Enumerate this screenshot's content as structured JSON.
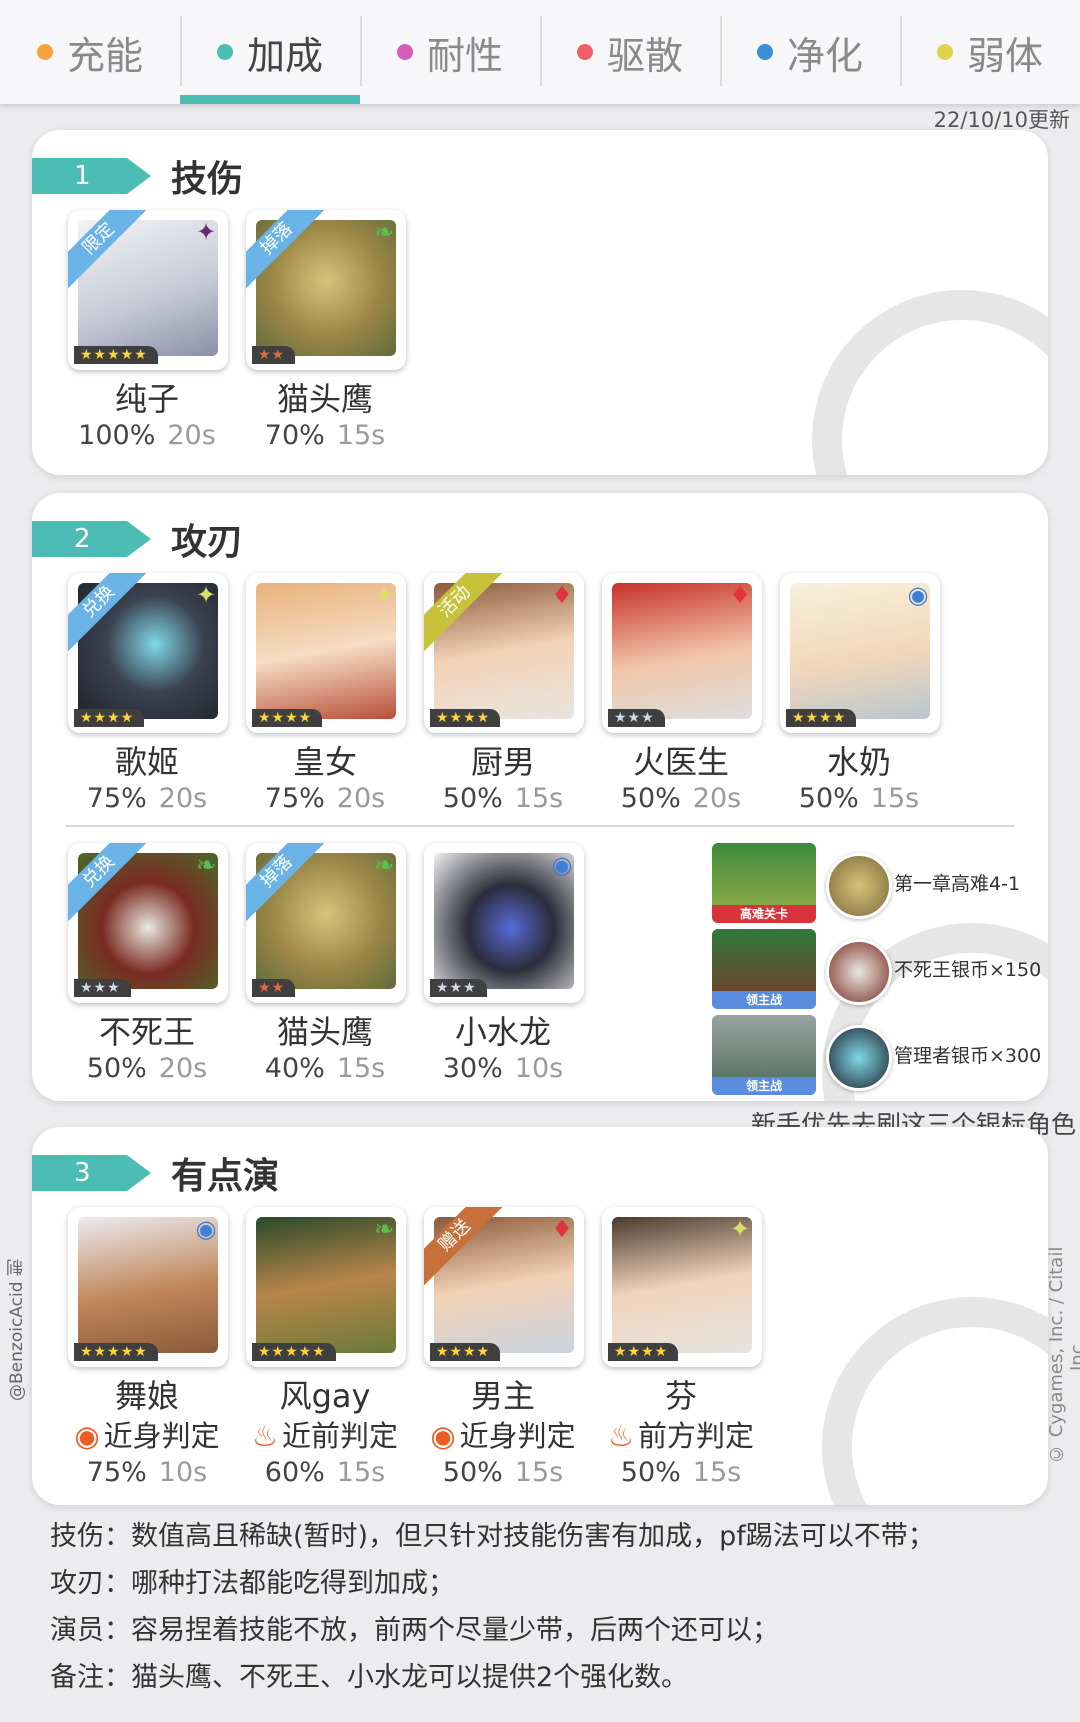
{
  "tabs": [
    {
      "label": "充能",
      "color": "#f5a33a",
      "active": false
    },
    {
      "label": "加成",
      "color": "#4cbdb4",
      "active": true
    },
    {
      "label": "耐性",
      "color": "#d65db8",
      "active": false
    },
    {
      "label": "驱散",
      "color": "#ef5f6b",
      "active": false
    },
    {
      "label": "净化",
      "color": "#3b8ed8",
      "active": false
    },
    {
      "label": "弱体",
      "color": "#dfd24c",
      "active": false
    }
  ],
  "update_text": "22/10/10更新",
  "sections": [
    {
      "num": "1",
      "title": "技伤"
    },
    {
      "num": "2",
      "title": "攻刃"
    },
    {
      "num": "3",
      "title": "有点演"
    }
  ],
  "s1": [
    {
      "name": "纯子",
      "pct": "100%",
      "sec": "20s",
      "stars": "★★★★★",
      "ribbon": "限定",
      "attr_icon": "dark-icon"
    },
    {
      "name": "猫头鹰",
      "pct": "70%",
      "sec": "15s",
      "stars": "★★",
      "ribbon": "掉落",
      "attr_icon": "wind-icon"
    }
  ],
  "s2": [
    {
      "name": "歌姬",
      "pct": "75%",
      "sec": "20s",
      "stars": "★★★★",
      "ribbon": "兑换",
      "attr_icon": "light-icon"
    },
    {
      "name": "皇女",
      "pct": "75%",
      "sec": "20s",
      "stars": "★★★★",
      "ribbon": "",
      "attr_icon": "light-icon"
    },
    {
      "name": "厨男",
      "pct": "50%",
      "sec": "15s",
      "stars": "★★★★",
      "ribbon": "活动",
      "attr_icon": "fire-icon"
    },
    {
      "name": "火医生",
      "pct": "50%",
      "sec": "20s",
      "stars": "★★★",
      "ribbon": "",
      "attr_icon": "fire-icon"
    },
    {
      "name": "水奶",
      "pct": "50%",
      "sec": "15s",
      "stars": "★★★★",
      "ribbon": "",
      "attr_icon": "water-icon"
    },
    {
      "name": "不死王",
      "pct": "50%",
      "sec": "20s",
      "stars": "★★★",
      "ribbon": "兑换",
      "attr_icon": "wind-icon"
    },
    {
      "name": "猫头鹰",
      "pct": "40%",
      "sec": "15s",
      "stars": "★★",
      "ribbon": "掉落",
      "attr_icon": "wind-icon"
    },
    {
      "name": "小水龙",
      "pct": "30%",
      "sec": "10s",
      "stars": "★★★",
      "ribbon": "",
      "attr_icon": "water-icon"
    }
  ],
  "drops": [
    {
      "tag": "高难关卡",
      "text": "第一章高难4-1"
    },
    {
      "tag": "领主战",
      "text": "不死王银币×150"
    },
    {
      "tag": "领主战",
      "text": "管理者银币×300"
    }
  ],
  "drops_note": "新手优先去刷这三个银标角色",
  "s3": [
    {
      "name": "舞娘",
      "judge": "近身判定",
      "pct": "75%",
      "sec": "10s",
      "stars": "★★★★★",
      "ribbon": "",
      "attr_icon": "water-icon"
    },
    {
      "name": "风gay",
      "judge": "近前判定",
      "pct": "60%",
      "sec": "15s",
      "stars": "★★★★★",
      "ribbon": "",
      "attr_icon": "wind-icon"
    },
    {
      "name": "男主",
      "judge": "近身判定",
      "pct": "50%",
      "sec": "15s",
      "stars": "★★★★",
      "ribbon": "赠送",
      "attr_icon": "fire-icon"
    },
    {
      "name": "芬",
      "judge": "前方判定",
      "pct": "50%",
      "sec": "15s",
      "stars": "★★★★",
      "ribbon": "",
      "attr_icon": "light-icon"
    }
  ],
  "notes": [
    {
      "label": "技伤",
      "text": "数值高且稀缺(暂时)，但只针对技能伤害有加成，pf踢法可以不带；"
    },
    {
      "label": "攻刃",
      "text": "哪种打法都能吃得到加成；"
    },
    {
      "label": "演员",
      "text": "容易捏着技能不放，前两个尽量少带，后两个还可以；"
    },
    {
      "label": "备注",
      "text": "猫头鹰、不死王、小水龙可以提供2个强化数。"
    }
  ],
  "credit_left": "@BenzoicAcid 制",
  "credit_right": "© Cygames, Inc. / Citail Inc."
}
